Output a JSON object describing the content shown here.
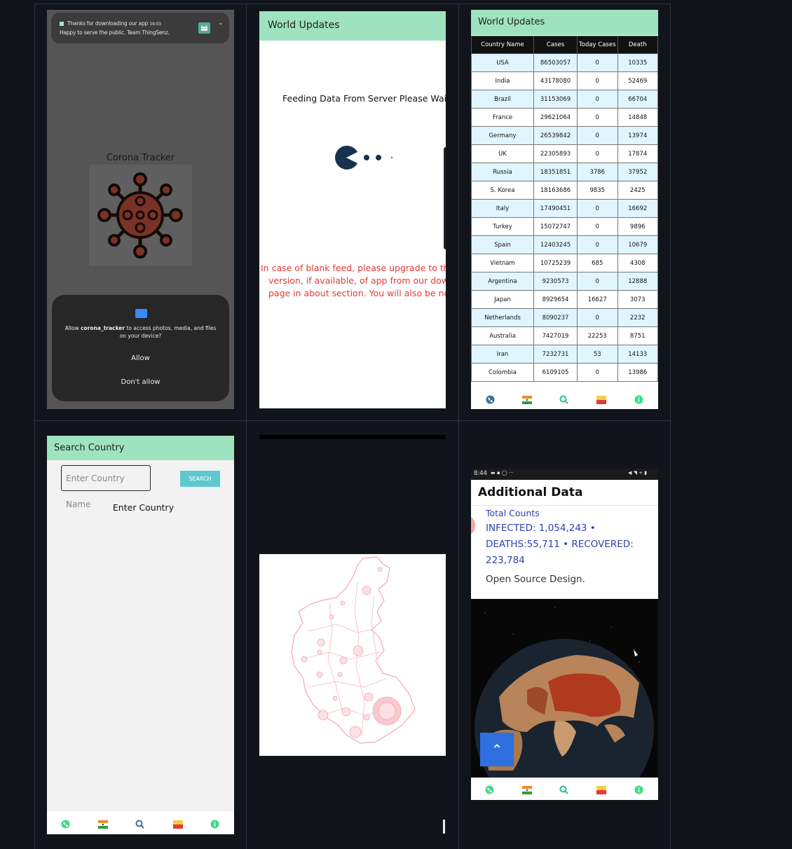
{
  "splash": {
    "notification_title": "Thanks for downloading our app",
    "notification_time": "19:03",
    "notification_body": "Happy to serve the public. Team ThingSenz.",
    "app_title": "Corona Tracker",
    "permission_prefix": "Allow",
    "permission_app": "corona_tracker",
    "permission_suffix": "to access photos, media, and files on your device?",
    "allow_label": "Allow",
    "deny_label": "Don't allow"
  },
  "loading": {
    "title": "World Updates",
    "feeding_text": "Feeding Data From Server Please Wait..",
    "notice_line1": "In case of blank feed, please upgrade to the",
    "notice_line2": "version, if available, of app from our downl",
    "notice_line3": "page in about section. You will also be not"
  },
  "world": {
    "title": "World Updates",
    "columns": [
      "Country Name",
      "Cases",
      "Today Cases",
      "Death"
    ],
    "rows": [
      [
        "USA",
        "86503057",
        "0",
        "10335"
      ],
      [
        "India",
        "43178080",
        "0",
        "52469"
      ],
      [
        "Brazil",
        "31153069",
        "0",
        "66704"
      ],
      [
        "France",
        "29621064",
        "0",
        "14848"
      ],
      [
        "Germany",
        "26539842",
        "0",
        "13974"
      ],
      [
        "UK",
        "22305893",
        "0",
        "17874"
      ],
      [
        "Russia",
        "18351851",
        "3786",
        "37952"
      ],
      [
        "S. Korea",
        "18163686",
        "9835",
        "2425"
      ],
      [
        "Italy",
        "17490451",
        "0",
        "16692"
      ],
      [
        "Turkey",
        "15072747",
        "0",
        "9896"
      ],
      [
        "Spain",
        "12403245",
        "0",
        "10679"
      ],
      [
        "Vietnam",
        "10725239",
        "685",
        "4308"
      ],
      [
        "Argentina",
        "9230573",
        "0",
        "12888"
      ],
      [
        "Japan",
        "8929654",
        "16627",
        "3073"
      ],
      [
        "Netherlands",
        "8090237",
        "0",
        "2232"
      ],
      [
        "Australia",
        "7427019",
        "22253",
        "8751"
      ],
      [
        "Iran",
        "7232731",
        "53",
        "14133"
      ],
      [
        "Colombia",
        "6109105",
        "0",
        "13986"
      ]
    ]
  },
  "search": {
    "title": "Search Country",
    "placeholder": "Enter Country Name",
    "button_label": "SEARCH",
    "result_label": "Enter Country"
  },
  "additional": {
    "status_time": "8:44",
    "heading": "Additional Data",
    "total_counts": "Total Counts",
    "infected": "INFECTED: 1,054,243 •",
    "deaths": "DEATHS:55,711 • RECOVERED:",
    "recovered_value": "223,784",
    "open_source": "Open Source Design.",
    "up_icon": "chevron-up-icon"
  },
  "nav_icons": [
    "globe-icon",
    "india-flag-icon",
    "search-icon",
    "karnataka-flag-icon",
    "info-icon"
  ],
  "colors": {
    "appbar": "#9fe2bf",
    "alert_red": "#e53935",
    "table_header": "#111111",
    "row_highlight": "#e1f5fe",
    "search_button": "#5ec8cf",
    "stats_blue": "#2f3fb0",
    "scroll_button": "#2f6fe0"
  }
}
